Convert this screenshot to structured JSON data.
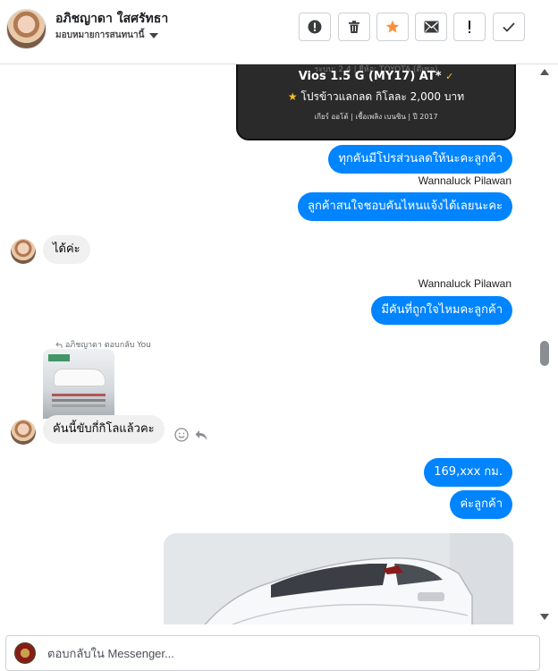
{
  "header": {
    "contact_name": "อภิชญาดา ใสศรัทธา",
    "contact_subtitle": "มอบหมายการสนทนานี้",
    "toolbar": [
      {
        "name": "report-spam-button",
        "icon": "exclamation-circle-icon",
        "tooltip": ""
      },
      {
        "name": "delete-button",
        "icon": "trash-icon",
        "tooltip": ""
      },
      {
        "name": "star-button",
        "icon": "star-icon",
        "tooltip": ""
      },
      {
        "name": "mark-unread-button",
        "icon": "envelope-icon",
        "tooltip": ""
      },
      {
        "name": "follow-up-button",
        "icon": "exclamation-icon",
        "tooltip": ""
      },
      {
        "name": "mark-done-button",
        "icon": "checkmark-icon",
        "tooltip": ""
      }
    ]
  },
  "colors": {
    "outgoing_bubble": "#0084ff",
    "incoming_bubble": "#f0f0f0",
    "star_button": "#f7923a"
  },
  "card": {
    "specs_top": "ระบบ: 2.4  |  ยี่ห้อ: TOYOTA (ดีเซล)",
    "model": "Vios 1.5 G (MY17) AT*",
    "promo": "โปรข้าวแลกลด กิโลละ 2,000 บาท",
    "specs": "เกียร์ ออโต้  |  เชื้อเพลิง เบนซิน  |  ปี 2017"
  },
  "messages": {
    "m1": "ทุกคันมีโปรส่วนลดให้นะคะลูกค้า",
    "sender1": "Wannaluck Pilawan",
    "m2": "ลูกค้าสนใจชอบคันไหนแจ้งได้เลยนะคะ",
    "m3": "ได้ค่ะ",
    "sender2": "Wannaluck Pilawan",
    "m4": "มีคันที่ถูกใจไหมคะลูกค้า",
    "reply_label": "อภิชญาดา ตอบกลับ You",
    "m5": "คันนี้ขับกี่กิโลแล้วคะ",
    "m6": "169,xxx  กม.",
    "m7": "ค่ะลูกค้า"
  },
  "composer": {
    "placeholder": "ตอบกลับใน Messenger..."
  }
}
